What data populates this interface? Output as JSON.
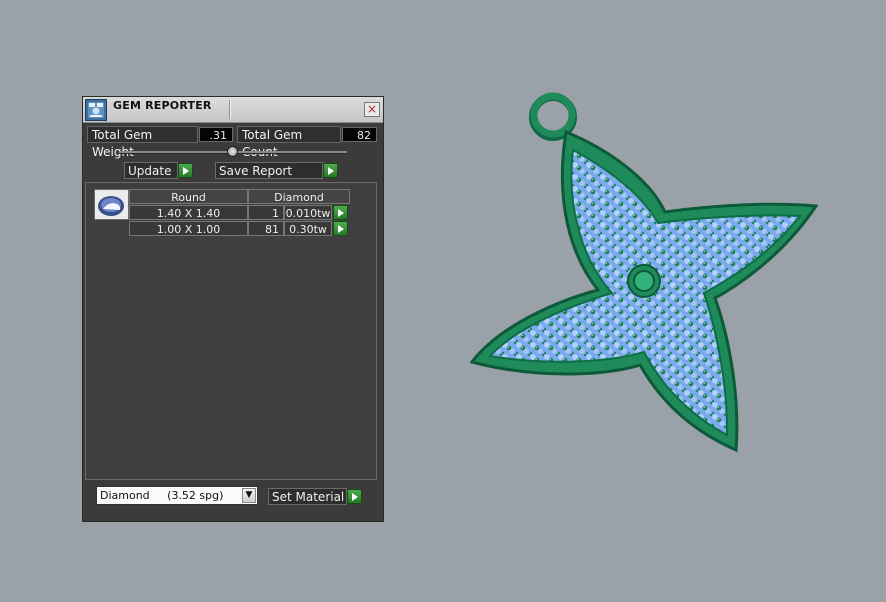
{
  "panel": {
    "title": "GEM REPORTER",
    "close_glyph": "×",
    "total_weight_label": "Total Gem Weight",
    "total_weight_value": ".31",
    "total_count_label": "Total Gem Count",
    "total_count_value": "82",
    "update_label": "Update",
    "save_report_label": "Save Report",
    "table": {
      "shape_header": "Round",
      "material_header": "Diamond",
      "rows": [
        {
          "size": "1.40 X 1.40",
          "count": "1",
          "weight": "0.010tw"
        },
        {
          "size": "1.00 X 1.00",
          "count": "81",
          "weight": "0.30tw"
        }
      ]
    },
    "material_select_value": "Diamond     (3.52 spg)",
    "set_material_label": "Set Material"
  },
  "colors": {
    "metal_green": "#1f8a5a",
    "gem_blue": "#8ab4f0",
    "background": "#9ba1a8",
    "play_button_green": "#2f8f2f"
  },
  "icons": {
    "app": "gem-reporter-app-icon",
    "close": "close-icon",
    "play": "play-arrow-icon",
    "dropdown": "chevron-down-icon"
  }
}
